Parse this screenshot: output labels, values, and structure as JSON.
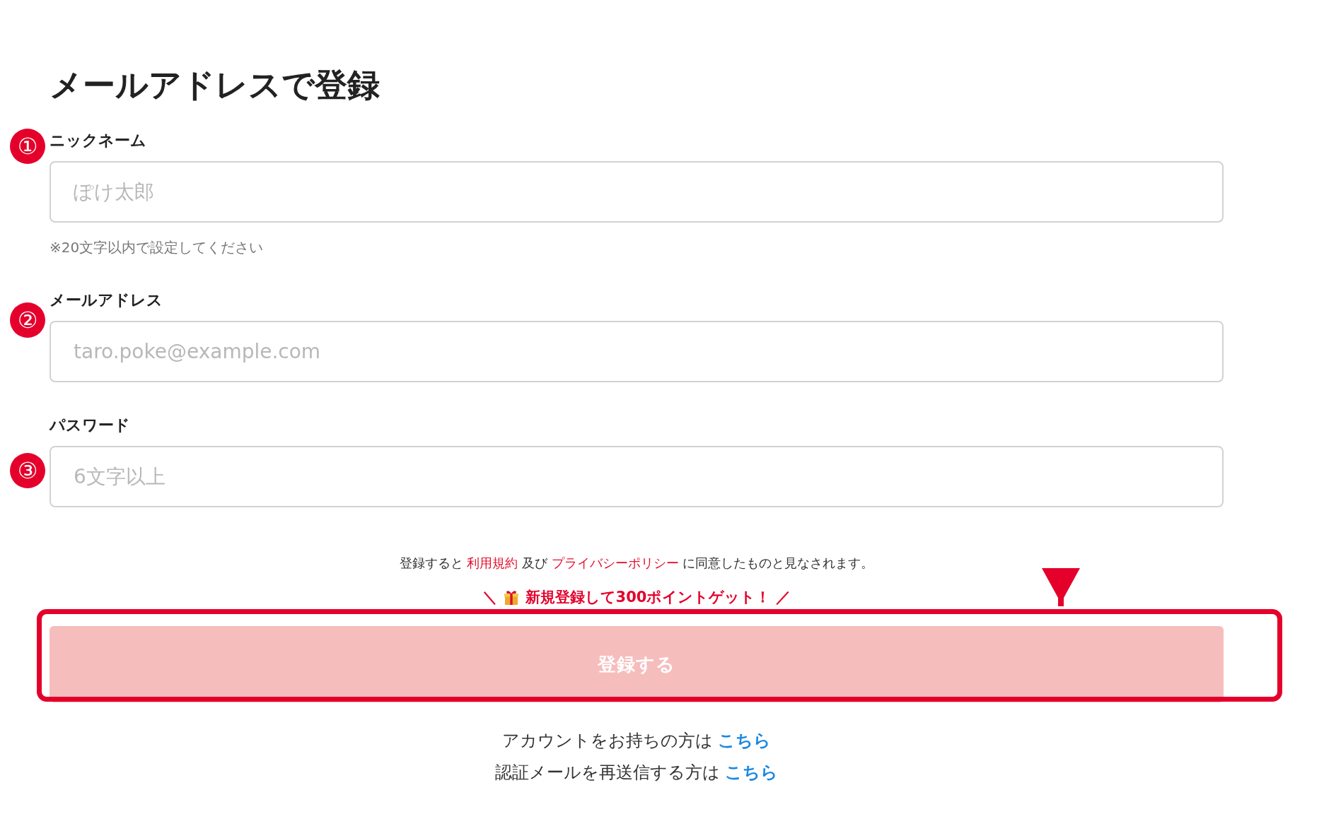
{
  "title": "メールアドレスで登録",
  "fields": [
    {
      "marker": "①",
      "label": "ニックネーム",
      "placeholder": "ぽけ太郎",
      "hint": "※20文字以内で設定してください"
    },
    {
      "marker": "②",
      "label": "メールアドレス",
      "placeholder": "taro.poke@example.com"
    },
    {
      "marker": "③",
      "label": "パスワード",
      "placeholder": "6文字以上"
    }
  ],
  "terms": {
    "before": "登録すると",
    "terms_link": "利用規約",
    "middle": "及び",
    "privacy_link": "プライバシーポリシー",
    "after": "に同意したものと見なされます。"
  },
  "promo": {
    "left_mark": "＼",
    "text": "新規登録して300ポイントゲット！",
    "right_mark": "／"
  },
  "submit_button": {
    "label": "登録する",
    "disabled": true
  },
  "footer_links": [
    {
      "text": "アカウントをお持ちの方は",
      "link": "こちら"
    },
    {
      "text": "認証メールを再送信する方は",
      "link": "こちら"
    }
  ]
}
